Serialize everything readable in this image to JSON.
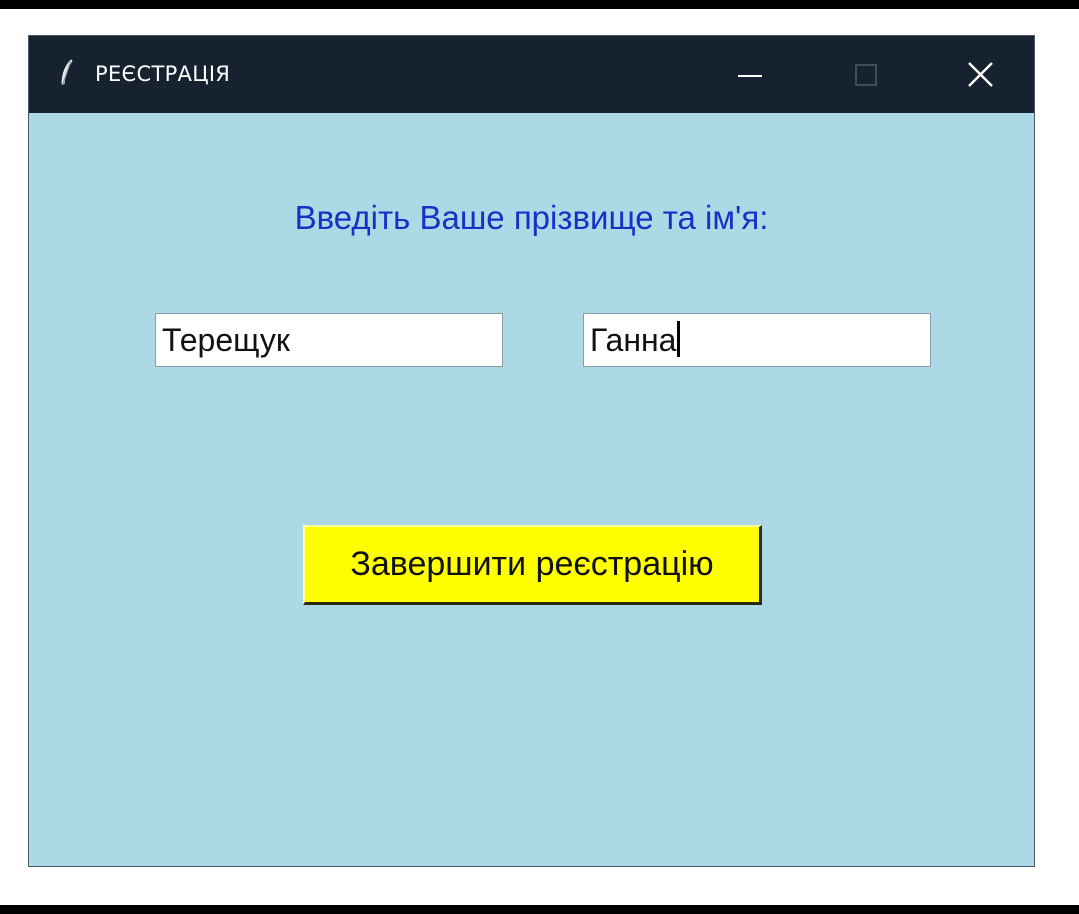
{
  "window": {
    "title": "РЕЄСТРАЦІЯ",
    "app_icon": "feather-icon",
    "controls": {
      "minimize_icon": "minimize-icon",
      "maximize_icon": "maximize-icon",
      "close_icon": "close-icon"
    }
  },
  "form": {
    "prompt": "Введіть Ваше прізвище та ім'я:",
    "surname_value": "Терещук",
    "name_value": "Ганна",
    "submit_label": "Завершити реєстрацію"
  },
  "colors": {
    "titlebar_bg": "#16222f",
    "client_bg": "#add8e6",
    "prompt_text": "#1c2fc4",
    "button_bg": "#ffff00"
  }
}
